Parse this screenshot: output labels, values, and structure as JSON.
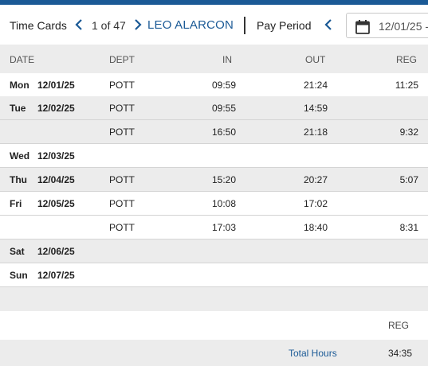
{
  "colors": {
    "accent": "#1b5a96",
    "row_shade": "#ececec"
  },
  "header": {
    "title": "Time Cards",
    "prev_icon": "chevron-left-icon",
    "count": "1 of 47",
    "next_icon": "chevron-right-icon",
    "employee_name": "LEO ALARCON",
    "pay_period_label": "Pay Period",
    "period_prev_icon": "chevron-left-icon",
    "calendar_icon": "calendar-icon",
    "period_date": "12/01/25 -"
  },
  "table": {
    "columns": {
      "date": "DATE",
      "dept": "DEPT",
      "in": "IN",
      "out": "OUT",
      "reg": "REG"
    },
    "rows": [
      {
        "day": "Mon",
        "date": "12/01/25",
        "dept": "POTT",
        "in": "09:59",
        "out": "21:24",
        "reg": "11:25"
      },
      {
        "day": "Tue",
        "date": "12/02/25",
        "dept": "POTT",
        "in": "09:55",
        "out": "14:59",
        "reg": ""
      },
      {
        "day": "",
        "date": "",
        "dept": "POTT",
        "in": "16:50",
        "out": "21:18",
        "reg": "9:32"
      },
      {
        "day": "Wed",
        "date": "12/03/25",
        "dept": "",
        "in": "",
        "out": "",
        "reg": ""
      },
      {
        "day": "Thu",
        "date": "12/04/25",
        "dept": "POTT",
        "in": "15:20",
        "out": "20:27",
        "reg": "5:07"
      },
      {
        "day": "Fri",
        "date": "12/05/25",
        "dept": "POTT",
        "in": "10:08",
        "out": "17:02",
        "reg": ""
      },
      {
        "day": "",
        "date": "",
        "dept": "POTT",
        "in": "17:03",
        "out": "18:40",
        "reg": "8:31"
      },
      {
        "day": "Sat",
        "date": "12/06/25",
        "dept": "",
        "in": "",
        "out": "",
        "reg": ""
      },
      {
        "day": "Sun",
        "date": "12/07/25",
        "dept": "",
        "in": "",
        "out": "",
        "reg": ""
      }
    ]
  },
  "totals": {
    "column": "REG",
    "label": "Total Hours",
    "value": "34:35"
  }
}
